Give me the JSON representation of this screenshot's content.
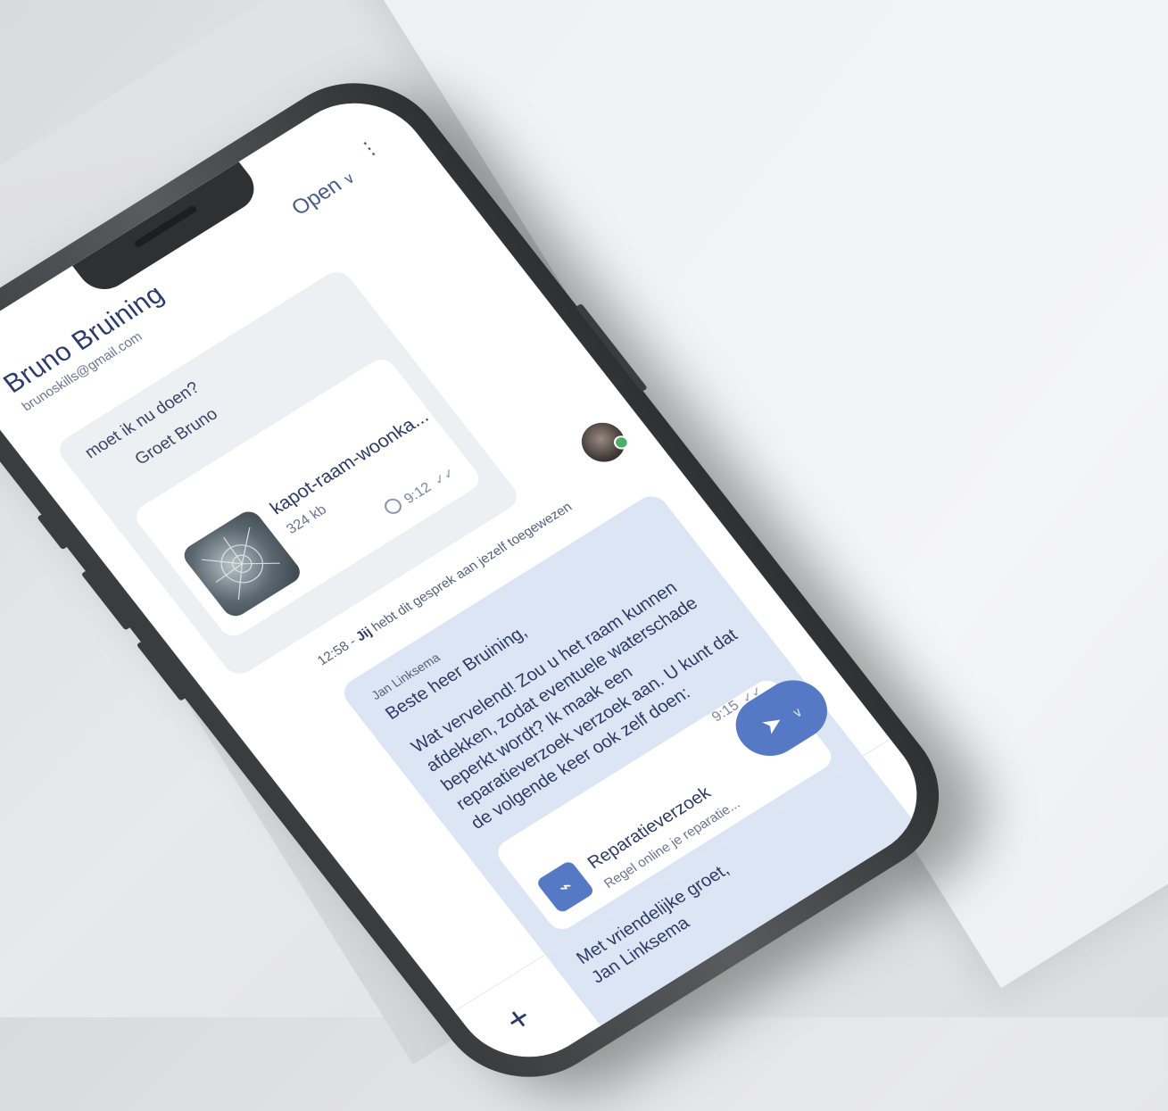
{
  "header": {
    "contact_name": "Bruno Bruining",
    "contact_email": "brunoskills@gmail.com",
    "status_label": "Open",
    "status_chevron": "∨",
    "more_icon": "⋮"
  },
  "incoming": {
    "lines": [
      "moet ik nu doen?",
      "Groet Bruno"
    ],
    "attachment": {
      "file_name": "kapot-raam-woonka...",
      "file_size": "324 kb",
      "time": "9:12",
      "read_icon": "✓✓"
    }
  },
  "system_message": {
    "time_prefix": "12:58 - ",
    "actor": "Jij",
    "text": " hebt dit gesprek aan jezelf toegewezen"
  },
  "outgoing": {
    "sender": "Jan Linksema",
    "greeting": "Beste heer Bruining,",
    "body": "Wat vervelend! Zou u het raam kunnen afdekken, zodat eventuele waterschade beperkt wordt? Ik maak een reparatieverzoek verzoek aan. U kunt dat de volgende keer ook zelf doen:",
    "card": {
      "title": "Reparatieverzoek",
      "subtitle": "Regel online je reparatie...",
      "time": "9:15",
      "read_icon": "✓✓"
    },
    "closing_1": "Met vriendelijke groet,",
    "closing_2": "Jan Linksema"
  },
  "composer": {
    "add_icon": "+",
    "send_icon": "➤",
    "send_chevron": "∨"
  },
  "colors": {
    "accent": "#5579c4",
    "outgoing_bubble": "#dbe5f4",
    "incoming_bubble": "#edf0f3",
    "text_primary": "#2d3a66",
    "online": "#4bb06a"
  }
}
